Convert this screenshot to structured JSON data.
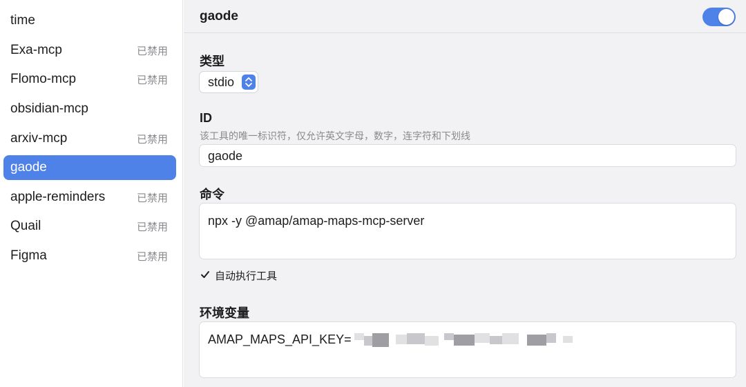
{
  "sidebar": {
    "items": [
      {
        "label": "time",
        "status": ""
      },
      {
        "label": "Exa-mcp",
        "status": "已禁用"
      },
      {
        "label": "Flomo-mcp",
        "status": "已禁用"
      },
      {
        "label": "obsidian-mcp",
        "status": ""
      },
      {
        "label": "arxiv-mcp",
        "status": "已禁用"
      },
      {
        "label": "gaode",
        "status": "",
        "active": true
      },
      {
        "label": "apple-reminders",
        "status": "已禁用"
      },
      {
        "label": "Quail",
        "status": "已禁用"
      },
      {
        "label": "Figma",
        "status": "已禁用"
      }
    ]
  },
  "detail": {
    "title": "gaode",
    "enabled": true,
    "type_label": "类型",
    "type_value": "stdio",
    "id_label": "ID",
    "id_hint": "该工具的唯一标识符，仅允许英文字母，数字，连字符和下划线",
    "id_value": "gaode",
    "command_label": "命令",
    "command_value": "npx -y @amap/amap-maps-mcp-server",
    "auto_exec_label": "自动执行工具",
    "auto_exec_checked": true,
    "env_label": "环境变量",
    "env_value": "AMAP_MAPS_API_KEY="
  },
  "icons": {
    "toggle": "toggle-switch",
    "select": "chevron-up-down-icon",
    "checkbox": "checkmark-icon"
  },
  "colors": {
    "accent": "#4f82e8",
    "panel": "#f2f2f4",
    "muted": "#8a8a8e"
  }
}
